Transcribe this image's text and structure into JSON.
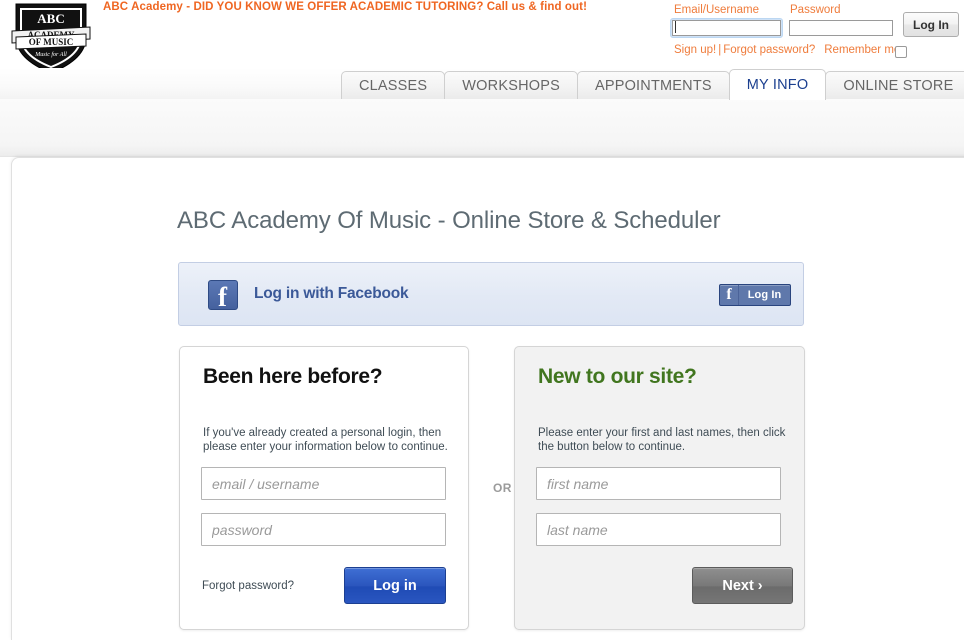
{
  "header": {
    "logo_alt": "ABC Academy Of Music",
    "logo_line1": "ABC",
    "logo_line2": "ACADEMY",
    "logo_line3": "OF MUSIC",
    "logo_tagline": "Music for All",
    "promo": "ABC Academy - DID YOU KNOW WE OFFER ACADEMIC TUTORING? Call us & find out!",
    "promo_color": "#ef6622",
    "login": {
      "email_label": "Email/Username",
      "email_value": "",
      "password_label": "Password",
      "password_value": "",
      "login_button": "Log In",
      "signup_link": "Sign up!",
      "separator": "|",
      "forgot_link": "Forgot password?",
      "remember_label": "Remember me",
      "remember_checked": false,
      "link_color": "#ef7c3c"
    }
  },
  "nav": {
    "tabs": [
      {
        "label": "CLASSES",
        "active": false
      },
      {
        "label": "WORKSHOPS",
        "active": false
      },
      {
        "label": "APPOINTMENTS",
        "active": false
      },
      {
        "label": "MY INFO",
        "active": true
      },
      {
        "label": "ONLINE STORE",
        "active": false
      }
    ],
    "active_color": "#1b3f8f"
  },
  "main": {
    "title": "ABC Academy Of Music - Online Store & Scheduler",
    "facebook": {
      "icon": "facebook-icon",
      "text": "Log in with Facebook",
      "button_label": "Log In",
      "brand_color": "#3b5998"
    },
    "or_label": "OR",
    "returning": {
      "heading": "Been here before?",
      "description": "If you've already created a personal login, then please enter your information below to continue.",
      "username_placeholder": "email / username",
      "username_value": "",
      "password_placeholder": "password",
      "password_value": "",
      "forgot_label": "Forgot password?",
      "submit_label": "Log in",
      "submit_color": "#2a55bd"
    },
    "newuser": {
      "heading": "New to our site?",
      "heading_color": "#41761f",
      "description": "Please enter your first and last names, then click the button below to continue.",
      "first_placeholder": "first name",
      "first_value": "",
      "last_placeholder": "last name",
      "last_value": "",
      "next_label": "Next ›"
    }
  }
}
